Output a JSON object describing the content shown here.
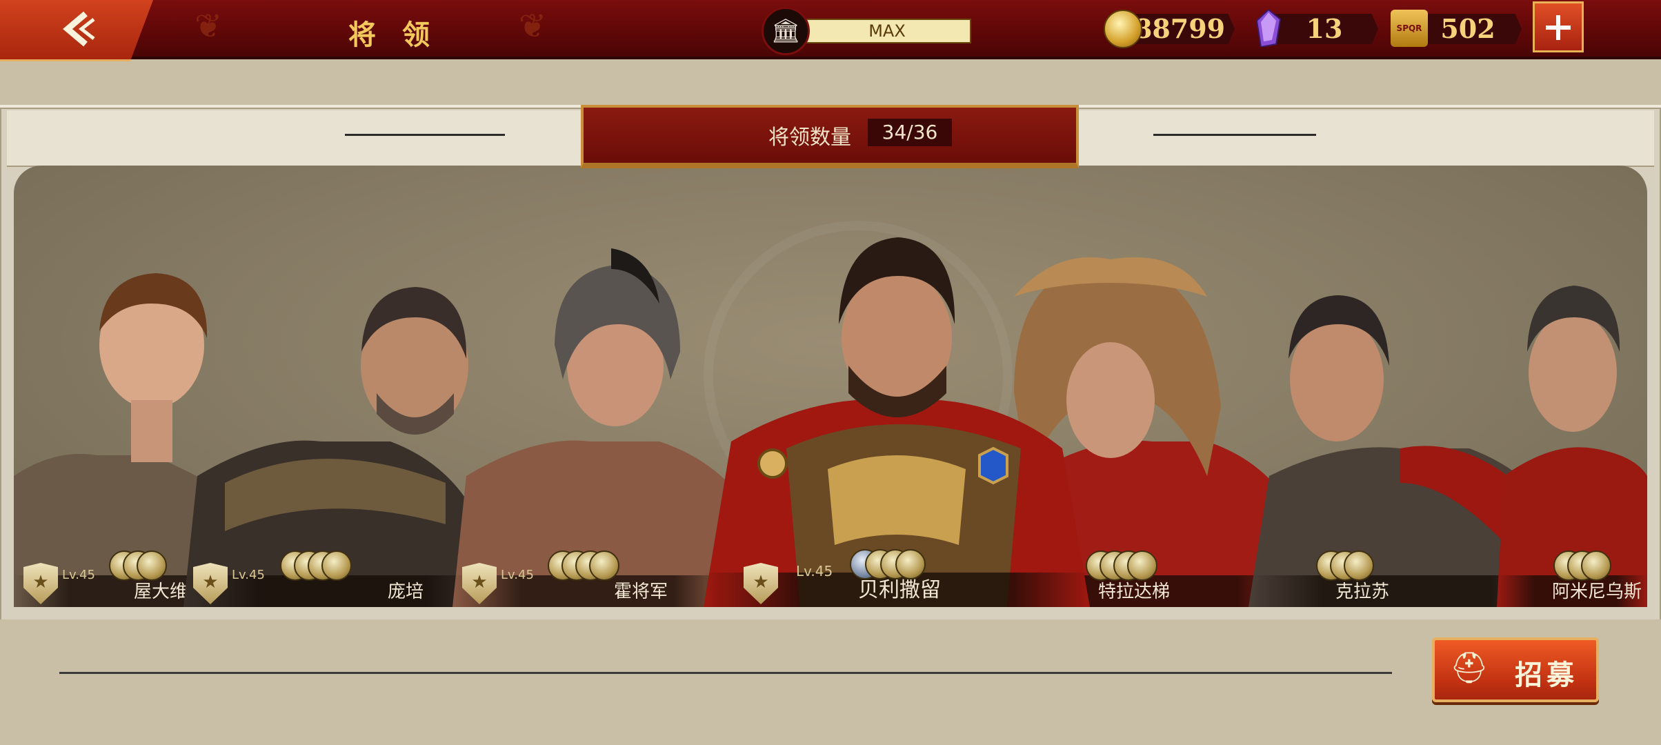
{
  "header": {
    "title": "将 领",
    "max_label": "MAX",
    "back_icon": "chevron-left-icon"
  },
  "resources": {
    "coins": "88799",
    "gems": "13",
    "spqr": "502",
    "spqr_emblem_text": "SPQR"
  },
  "panel": {
    "count_label": "将领数量",
    "count_value": "34/36"
  },
  "generals": [
    {
      "name": "屋大维",
      "level": "Lv.45"
    },
    {
      "name": "庞培",
      "level": "Lv.45"
    },
    {
      "name": "霍将军",
      "level": "Lv.45"
    },
    {
      "name": "贝利撒留",
      "level": "Lv.45"
    },
    {
      "name": "特拉达梯",
      "level": ""
    },
    {
      "name": "克拉苏",
      "level": ""
    },
    {
      "name": "阿米尼乌斯",
      "level": ""
    }
  ],
  "recruit": {
    "label": "招募"
  },
  "colors": {
    "topbar": "#6b0a0a",
    "accent_orange": "#d1421d",
    "gold": "#f3c95c",
    "panel_bg": "#857a63"
  }
}
